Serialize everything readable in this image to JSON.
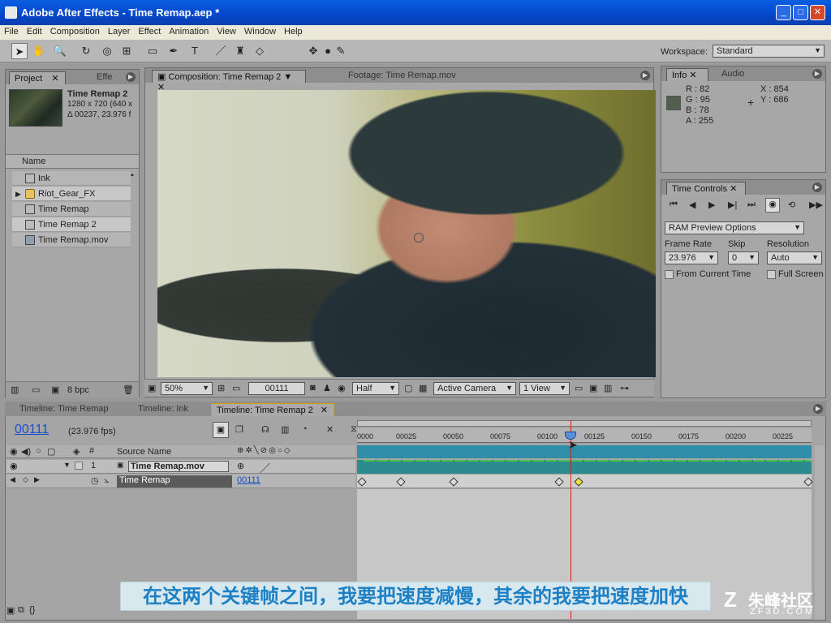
{
  "window": {
    "title": "Adobe After Effects - Time Remap.aep *",
    "min": "_",
    "max": "□",
    "close": "✕"
  },
  "menu": [
    "File",
    "Edit",
    "Composition",
    "Layer",
    "Effect",
    "Animation",
    "View",
    "Window",
    "Help"
  ],
  "toolbar": {
    "tools": [
      "selection-tool",
      "hand-tool",
      "zoom-tool",
      "rotation-tool",
      "camera-orbit-tool",
      "pan-behind-tool",
      "rectangle-mask-tool",
      "pen-tool",
      "text-tool",
      "brush-tool",
      "clone-stamp-tool",
      "eraser-tool",
      "puppet-tool"
    ],
    "workspace_label": "Workspace:",
    "workspace_value": "Standard"
  },
  "project_panel": {
    "tabs": [
      "Project",
      "Effe"
    ],
    "selected": {
      "name": "Time Remap 2",
      "size": "1280 x 720  (640 x",
      "duration": "Δ 00237, 23.976 f"
    },
    "name_header": "Name",
    "items": [
      {
        "label": "Ink",
        "type": "comp"
      },
      {
        "label": "Riot_Gear_FX",
        "type": "folder"
      },
      {
        "label": "Time Remap",
        "type": "comp"
      },
      {
        "label": "Time Remap 2",
        "type": "comp"
      },
      {
        "label": "Time Remap.mov",
        "type": "footage"
      }
    ],
    "bpc": "8 bpc"
  },
  "comp_panel": {
    "tab_active": "Composition: Time Remap 2",
    "tab_footage": "Footage: Time Remap.mov",
    "zoom": "50%",
    "timecode": "00111",
    "resolution": "Half",
    "camera": "Active Camera",
    "view": "1 View"
  },
  "info_panel": {
    "tabs": [
      "Info",
      "Audio"
    ],
    "r": "R : 82",
    "g": "G : 95",
    "b": "B : 78",
    "a": "A : 255",
    "x": "X : 854",
    "y": "Y : 686",
    "swatch_color": "#525f4e"
  },
  "time_controls": {
    "title": "Time Controls",
    "ram_preview": "RAM Preview Options",
    "frame_rate_label": "Frame Rate",
    "skip_label": "Skip",
    "resolution_label": "Resolution",
    "frame_rate_value": "23.976",
    "skip_value": "0",
    "resolution_value": "Auto",
    "from_current_time": "From Current Time",
    "full_screen": "Full Screen"
  },
  "timeline": {
    "tabs": [
      "Timeline: Time Remap",
      "Timeline: Ink",
      "Timeline: Time Remap 2"
    ],
    "current_time": "00111",
    "fps": "(23.976 fps)",
    "source_name_header": "Source Name",
    "layer_number": "1",
    "layer_name": "Time Remap.mov",
    "property_name": "Time Remap",
    "property_value": "00111",
    "ruler_labels": [
      "0000",
      "00025",
      "00050",
      "00075",
      "00100",
      "00125",
      "00150",
      "00175",
      "00200",
      "00225"
    ],
    "hash_label": "#"
  },
  "subtitle": "在这两个关键帧之间，我要把速度减慢，其余的我要把速度加快",
  "watermark": {
    "brand": "朱峰社区",
    "url": "ZF3D.COM"
  }
}
